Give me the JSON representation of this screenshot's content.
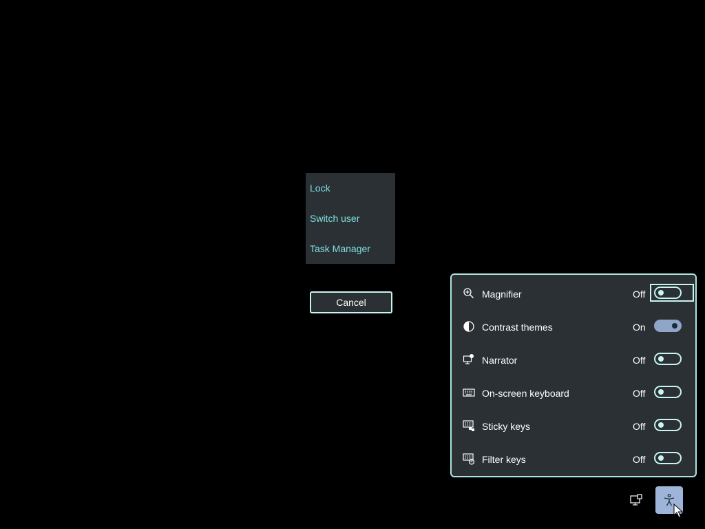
{
  "cad_menu": {
    "items": [
      {
        "label": "Lock"
      },
      {
        "label": "Switch user"
      },
      {
        "label": "Task Manager"
      }
    ],
    "cancel_label": "Cancel"
  },
  "accessibility": {
    "items": [
      {
        "label": "Magnifier",
        "state": "Off",
        "on": false,
        "icon": "magnifier-icon"
      },
      {
        "label": "Contrast themes",
        "state": "On",
        "on": true,
        "icon": "contrast-icon"
      },
      {
        "label": "Narrator",
        "state": "Off",
        "on": false,
        "icon": "narrator-icon"
      },
      {
        "label": "On-screen keyboard",
        "state": "Off",
        "on": false,
        "icon": "keyboard-icon"
      },
      {
        "label": "Sticky keys",
        "state": "Off",
        "on": false,
        "icon": "sticky-keys-icon"
      },
      {
        "label": "Filter keys",
        "state": "Off",
        "on": false,
        "icon": "filter-keys-icon"
      }
    ]
  },
  "taskbar": {
    "network_icon": "network-icon",
    "accessibility_icon": "accessibility-icon"
  },
  "colors": {
    "background": "#000000",
    "panel": "#2b3035",
    "accent_text": "#7fe0e0",
    "border": "#c8f5f0",
    "toggle_on": "#8fa6c8",
    "button_active": "#9eb4d8"
  }
}
